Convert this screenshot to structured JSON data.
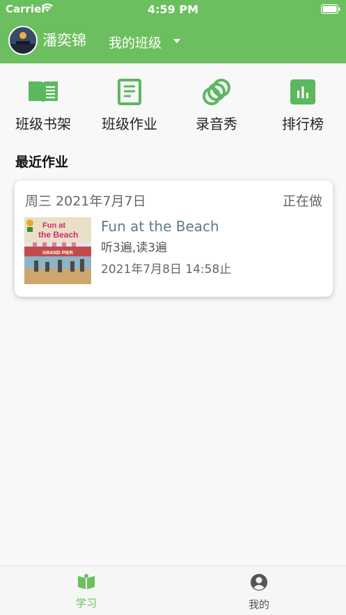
{
  "status_bar": {
    "carrier": "Carrier",
    "time": "4:59 PM"
  },
  "header": {
    "username": "潘奕锦",
    "class_selector": "我的班级",
    "theme_color": "#6cbf5e"
  },
  "menu": [
    {
      "label": "班级书架",
      "icon": "book-icon"
    },
    {
      "label": "班级作业",
      "icon": "document-icon"
    },
    {
      "label": "录音秀",
      "icon": "rings-icon"
    },
    {
      "label": "排行榜",
      "icon": "bar-chart-icon"
    }
  ],
  "section": {
    "title": "最近作业"
  },
  "assignment": {
    "date": "周三 2021年7月7日",
    "status": "正在做",
    "book_title": "Fun at the Beach",
    "requirement": "听3遍,读3遍",
    "due": "2021年7月8日 14:58止",
    "cover": {
      "title_line1": "Fun at",
      "title_line2": "the Beach",
      "sign": "GRAND PIER"
    }
  },
  "tabbar": {
    "tabs": [
      {
        "label": "学习",
        "icon": "study-book-icon",
        "active": true
      },
      {
        "label": "我的",
        "icon": "user-icon",
        "active": false
      }
    ],
    "active_color": "#6cbf5e",
    "inactive_color": "#555555"
  }
}
